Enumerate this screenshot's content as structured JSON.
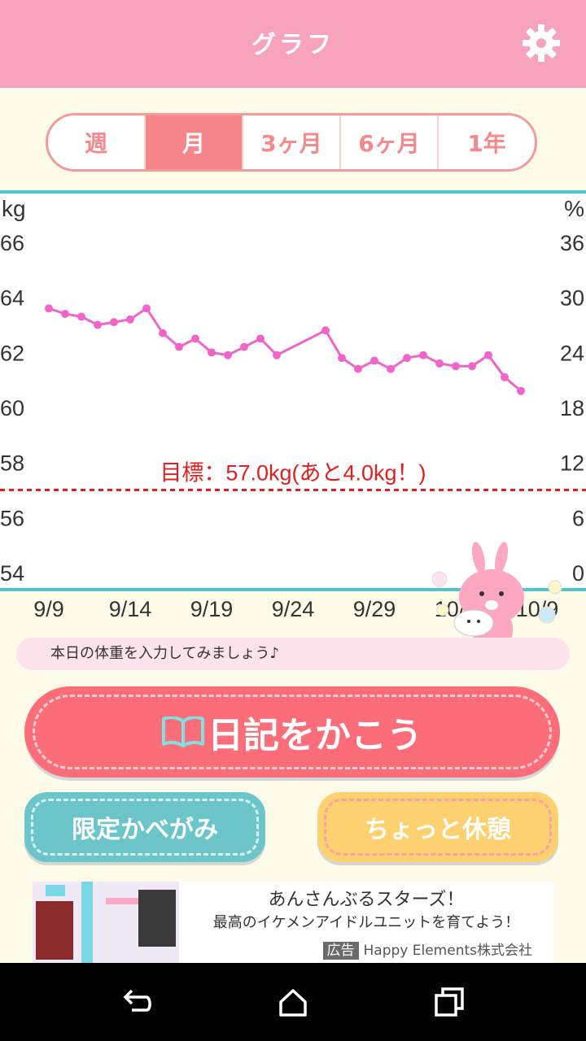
{
  "header": {
    "title": "グラフ",
    "settings_icon": "gear-icon"
  },
  "tabs": [
    {
      "label": "週",
      "active": false
    },
    {
      "label": "月",
      "active": true
    },
    {
      "label": "3ヶ月",
      "active": false
    },
    {
      "label": "6ヶ月",
      "active": false
    },
    {
      "label": "1年",
      "active": false
    }
  ],
  "chart_data": {
    "type": "line",
    "ylabel_left": "kg",
    "ylabel_right": "%",
    "left_ticks": [
      "66",
      "64",
      "62",
      "60",
      "58",
      "56",
      "54"
    ],
    "right_ticks": [
      "36",
      "30",
      "24",
      "18",
      "12",
      "6",
      "0"
    ],
    "ylim": [
      54,
      66
    ],
    "x_tick_labels": [
      "9/9",
      "9/14",
      "9/19",
      "9/24",
      "9/29",
      "10/4",
      "10/9"
    ],
    "series": [
      {
        "color": "#f065c7",
        "points": [
          {
            "day": 0,
            "kg": 63.6
          },
          {
            "day": 1,
            "kg": 63.4
          },
          {
            "day": 2,
            "kg": 63.3
          },
          {
            "day": 3,
            "kg": 63.0
          },
          {
            "day": 4,
            "kg": 63.1
          },
          {
            "day": 5,
            "kg": 63.2
          },
          {
            "day": 6,
            "kg": 63.6
          },
          {
            "day": 7,
            "kg": 62.7
          },
          {
            "day": 8,
            "kg": 62.2
          },
          {
            "day": 9,
            "kg": 62.5
          },
          {
            "day": 10,
            "kg": 62.0
          },
          {
            "day": 11,
            "kg": 61.9
          },
          {
            "day": 12,
            "kg": 62.2
          },
          {
            "day": 13,
            "kg": 62.5
          },
          {
            "day": 14,
            "kg": 61.9
          },
          {
            "day": 17,
            "kg": 62.8
          },
          {
            "day": 18,
            "kg": 61.8
          },
          {
            "day": 19,
            "kg": 61.4
          },
          {
            "day": 20,
            "kg": 61.7
          },
          {
            "day": 21,
            "kg": 61.4
          },
          {
            "day": 22,
            "kg": 61.8
          },
          {
            "day": 23,
            "kg": 61.9
          },
          {
            "day": 24,
            "kg": 61.6
          },
          {
            "day": 25,
            "kg": 61.5
          },
          {
            "day": 26,
            "kg": 61.5
          },
          {
            "day": 27,
            "kg": 61.9
          },
          {
            "day": 28,
            "kg": 61.1
          },
          {
            "day": 29,
            "kg": 60.6
          }
        ]
      }
    ],
    "target": {
      "value": 57.0,
      "label": "目標：57.0kg(あと4.0kg！)",
      "color": "#e02020"
    }
  },
  "message": "本日の体重を入力してみましょう♪",
  "buttons": {
    "diary": "日記をかこう",
    "wallpaper": "限定かべがみ",
    "rest": "ちょっと休憩"
  },
  "ad": {
    "title": "あんさんぶるスターズ！",
    "description": "最高のイケメンアイドルユニットを育てよう！",
    "label": "広告",
    "advertiser": "Happy Elements株式会社"
  }
}
